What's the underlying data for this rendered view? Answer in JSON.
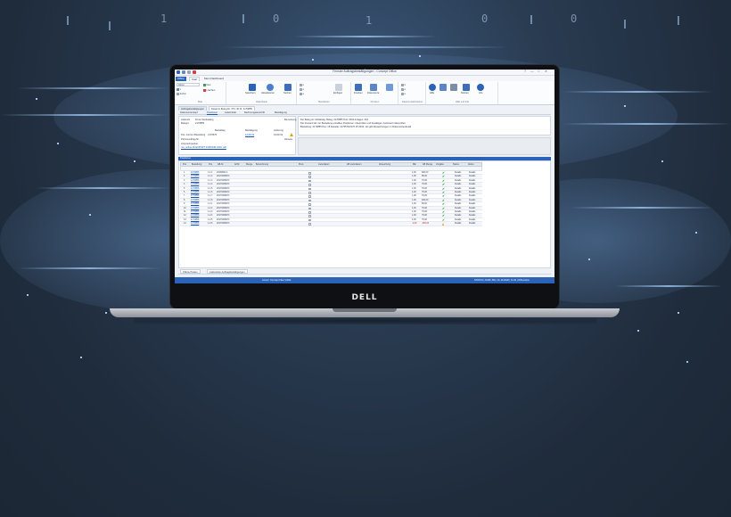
{
  "laptop": {
    "brand": "DELL"
  },
  "window": {
    "title": "Fenster Auftragsbestätigungen - Concept Office",
    "controls": [
      "?",
      "—",
      "□",
      "✕"
    ]
  },
  "ribbon": {
    "tabs": [
      "Office",
      "Start",
      "Mein Dashboard"
    ],
    "search_value": "Anzei",
    "groups": [
      {
        "label": "Start"
      },
      {
        "label": "Datenbank"
      },
      {
        "label": "Bearbeiten"
      },
      {
        "label": "Drucken"
      },
      {
        "label": "Datenzusatzbuttons"
      },
      {
        "label": "Hilfe und Info"
      }
    ],
    "buttons": {
      "neu": "Neu",
      "loeschen": "Löschen",
      "speichern": "Speichern",
      "aktualisieren": "Aktualisieren",
      "suchen": "Suchen",
      "archiv": "Archiv",
      "drucken": "Drucken",
      "dokumente": "Dokumente",
      "einfuegen": "Einfügen",
      "hilfe": "Hilfe",
      "info": "Info",
      "notizen": "Notizen"
    }
  },
  "doc_tabs": [
    "Auftragsbestätigungen",
    "Detail zu Beleg-Nr. 273, 46 Nr. 2170855"
  ],
  "sub_tabs": [
    "Dokumentenkopf",
    "Positionen",
    "Lieferinhalt",
    "Rechnungsanschrift",
    "Bestätigung"
  ],
  "header_fields": {
    "lieferant_label": "Lieferant",
    "lieferant_value": "Firma Textkatalog",
    "belegnr_label": "Belegnr.",
    "belegnr_value": "2170855",
    "date_labels": [
      "Bestelltag",
      "Bestätigung",
      "Lieferung"
    ],
    "pos_label": "Pos. zur/von Bestellung",
    "pos_value": "2170576",
    "bestaetigung_value": "12.09.19",
    "lieferung_value": "19.09.19",
    "partner_label": "Partnerauftrag Nr.",
    "ansprech_label": "Ansprechpartner",
    "ansprech_value": "ron_online 00 EXPORT KOPF/NR 1016 .pdf",
    "bemerk_label": "Bemerkung",
    "hinweis_label": "Hinweis"
  },
  "text_panel": {
    "lines": [
      "Der Beleg ist vollständig. Beleg: 2170855 Tool: 3004 Anlagen: 004",
      "Der Zustand der zur Bestellung erstellten Positionen: überprüfen und bestätigen, Lieferwert überprüfen",
      "Bestellung: 2170855 Pos: 15 Aktuelle: 2170576/2170 15 2019 - Es gibt Abweichungen im Dokumentendetail"
    ]
  },
  "positions": {
    "section_title": "Positionen",
    "columns": [
      "Pos",
      "Bestellung",
      "Pos",
      "AB-Nr",
      "ArtNr",
      "Menge",
      "Bezeichnung",
      "Preis",
      "Lieferdatum",
      "AB Lieferdatum",
      "Abweichung",
      "ME",
      "AB Menge",
      "Vorgabe",
      "Status",
      "Aktion"
    ],
    "rows": [
      {
        "pos": "1",
        "bestellung": "2170856",
        "pospos": "1.1.1",
        "abnr": "20190611 1",
        "artnr": "",
        "mengeA": "1,00",
        "mengeB": "600,00",
        "status": "ok",
        "b1": "Details",
        "b2": "Details"
      },
      {
        "pos": "2",
        "bestellung": "2170856",
        "pospos": "1.1.2",
        "abnr": "20170306071",
        "artnr": "",
        "mengeA": "1,00",
        "mengeB": "89,00",
        "status": "ok",
        "b1": "Details",
        "b2": "Details"
      },
      {
        "pos": "3",
        "bestellung": "2170856",
        "pospos": "1.1.3",
        "abnr": "20170306071",
        "artnr": "",
        "mengeA": "1,00",
        "mengeB": "79,00",
        "status": "ok",
        "b1": "Details",
        "b2": "Details"
      },
      {
        "pos": "4",
        "bestellung": "2170856",
        "pospos": "1.1.4",
        "abnr": "20170306071",
        "artnr": "",
        "mengeA": "1,00",
        "mengeB": "79,00",
        "status": "ok",
        "b1": "Details",
        "b2": "Details"
      },
      {
        "pos": "5",
        "bestellung": "2170856",
        "pospos": "1.1.5",
        "abnr": "20170306071",
        "artnr": "",
        "mengeA": "1,00",
        "mengeB": "79,00",
        "status": "ok",
        "b1": "Details",
        "b2": "Details"
      },
      {
        "pos": "6",
        "bestellung": "2170856",
        "pospos": "1.1.6",
        "abnr": "20170306071",
        "artnr": "",
        "mengeA": "1,00",
        "mengeB": "79,00",
        "status": "ok",
        "b1": "Details",
        "b2": "Details"
      },
      {
        "pos": "7",
        "bestellung": "2170856",
        "pospos": "1.1.7",
        "abnr": "20170306071",
        "artnr": "",
        "mengeA": "1,00",
        "mengeB": "79,00",
        "status": "ok",
        "b1": "Details",
        "b2": "Details"
      },
      {
        "pos": "8",
        "bestellung": "2170856",
        "pospos": "1.1.8",
        "abnr": "20170306071",
        "artnr": "",
        "mengeA": "1,00",
        "mengeB": "400,00",
        "status": "ok",
        "b1": "Details",
        "b2": "Details"
      },
      {
        "pos": "9",
        "bestellung": "2170856",
        "pospos": "1.2.1",
        "abnr": "20170306071",
        "artnr": "",
        "mengeA": "1,00",
        "mengeB": "89,00",
        "status": "ok",
        "b1": "Details",
        "b2": "Details"
      },
      {
        "pos": "10",
        "bestellung": "2170856",
        "pospos": "1.2.2",
        "abnr": "20170306071",
        "artnr": "",
        "mengeA": "1,00",
        "mengeB": "79,00",
        "status": "ok",
        "b1": "Details",
        "b2": "Details"
      },
      {
        "pos": "11",
        "bestellung": "2170856",
        "pospos": "1.2.3",
        "abnr": "20170306071",
        "artnr": "",
        "mengeA": "1,00",
        "mengeB": "79,00",
        "status": "ok",
        "b1": "Details",
        "b2": "Details"
      },
      {
        "pos": "12",
        "bestellung": "2170856",
        "pospos": "1.2.4",
        "abnr": "20170306071",
        "artnr": "",
        "mengeA": "1,00",
        "mengeB": "79,00",
        "status": "ok",
        "b1": "Details",
        "b2": "Details"
      },
      {
        "pos": "13",
        "bestellung": "2170856",
        "pospos": "1.2.5",
        "abnr": "20170306071",
        "artnr": "",
        "mengeA": "1,00",
        "mengeB": "79,00",
        "status": "ok",
        "b1": "Details",
        "b2": "Details"
      },
      {
        "pos": "14",
        "bestellung": "2170856",
        "pospos": "1.2.6",
        "abnr": "20170306071",
        "artnr": "",
        "mengeA": "-1,00",
        "mengeB": "-250,00",
        "status": "warn",
        "b1": "Details",
        "b2": "Details"
      }
    ]
  },
  "bottom_tabs": [
    "Offene Posten",
    "Lieferanten Auftragsbestätigungen"
  ],
  "statusbar": {
    "center": "Lizenz: Concept Files Vollsit",
    "right": "STATUS | NUM | 8% | 21.10.2020 | 11:31 | 8 Benutzer"
  },
  "colors": {
    "accent": "#2b63b8",
    "ok": "#2a9a3a",
    "warn": "#e3a21a",
    "negative": "#d02020"
  }
}
